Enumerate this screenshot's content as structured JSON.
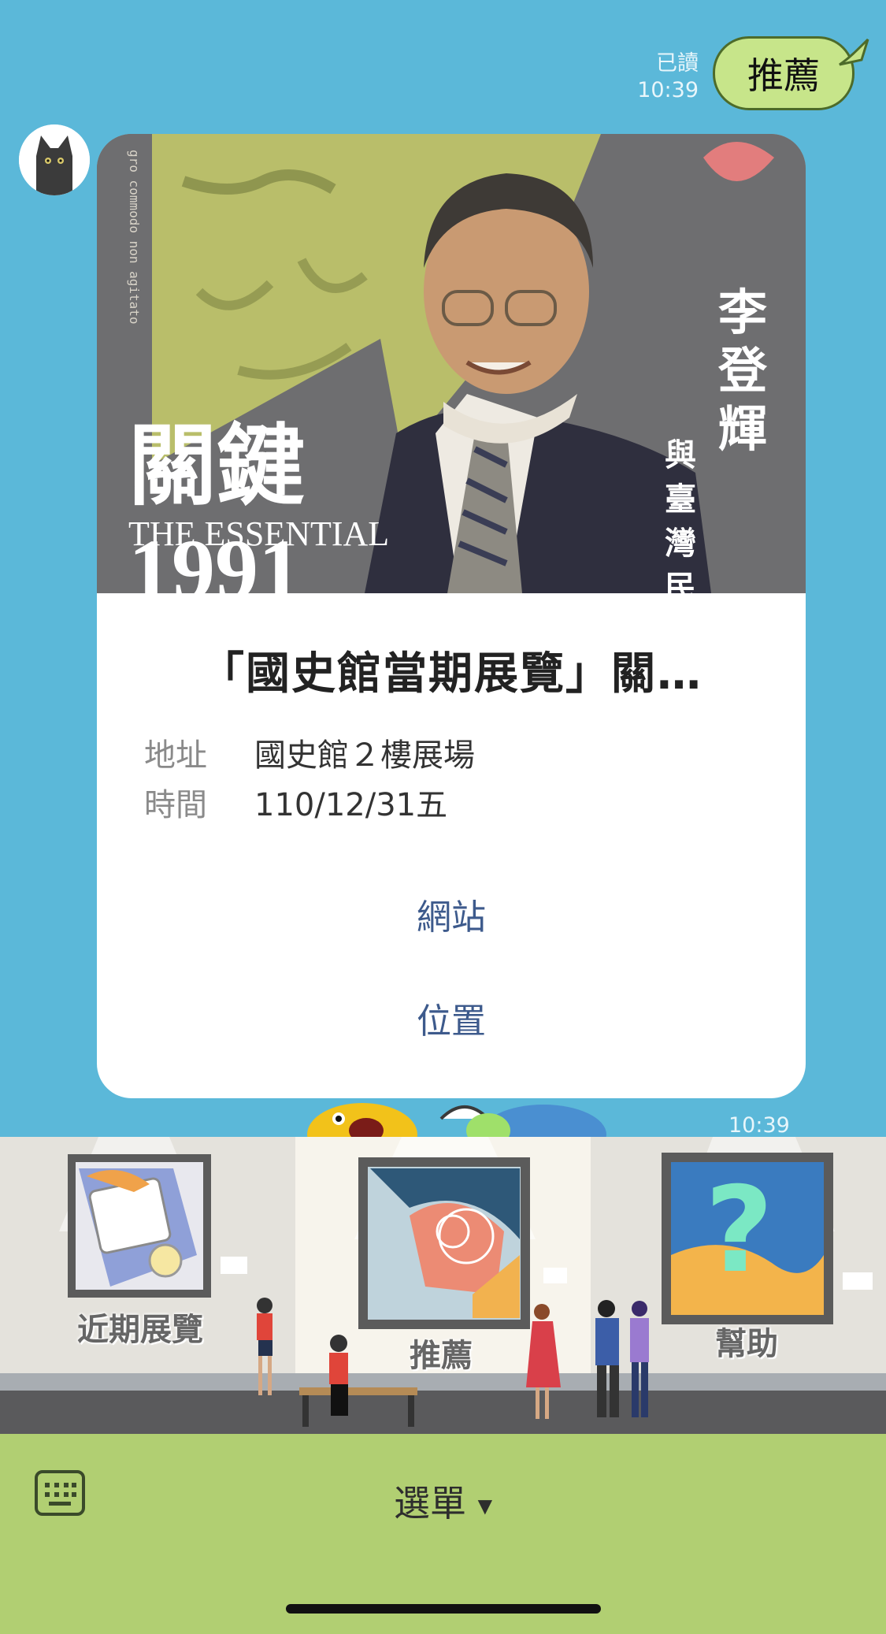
{
  "chat": {
    "outgoing": {
      "text": "推薦",
      "read_label": "已讀",
      "time": "10:39"
    },
    "incoming_time": "10:39"
  },
  "card": {
    "hero_text": {
      "big_title": "關鍵",
      "subtitle": "THE ESSENTIAL",
      "side_title": "李登輝",
      "side_sub": "與臺灣民",
      "vertical_motto": "gro commodo non agitato"
    },
    "title": "「國史館當期展覽」關…",
    "rows": [
      {
        "key": "地址",
        "value": "國史館２樓展場"
      },
      {
        "key": "時間",
        "value": "110/12/31五"
      }
    ],
    "actions": [
      "網站",
      "位置"
    ]
  },
  "rich_menu": {
    "items": [
      "近期展覽",
      "推薦",
      "幫助"
    ]
  },
  "bottom": {
    "menu_label": "選單",
    "keyboard_icon": "keyboard-icon",
    "caret_icon": "caret-down-icon"
  },
  "colors": {
    "chat_bg": "#5bb8d9",
    "bubble_out": "#c7e58a",
    "link": "#3d5a8c",
    "bottom_bar": "#b1cf72"
  }
}
